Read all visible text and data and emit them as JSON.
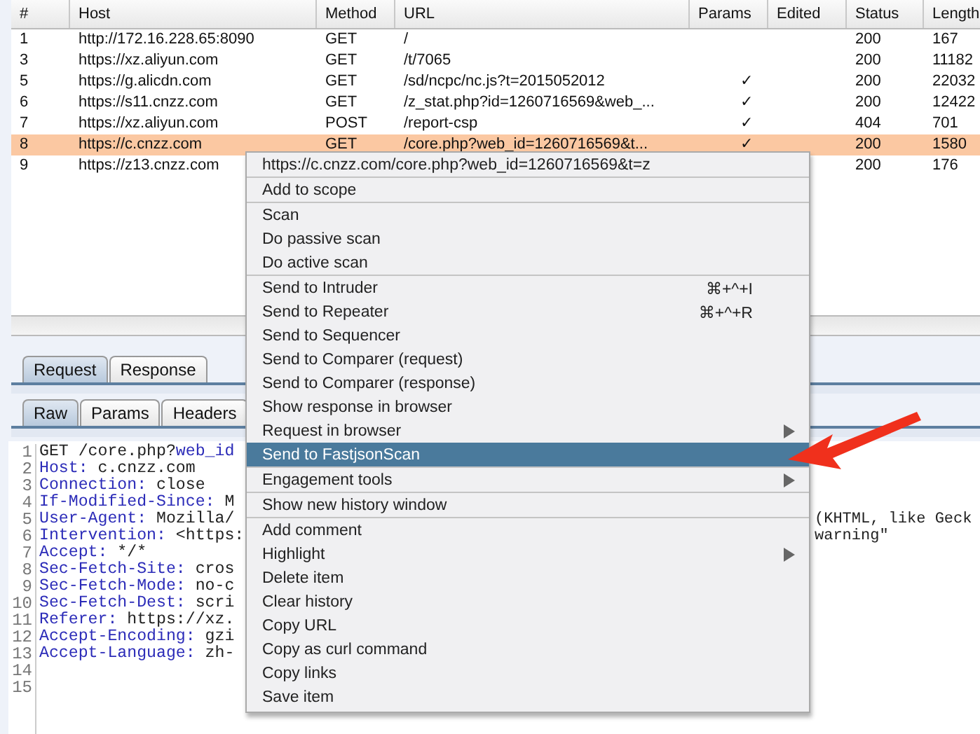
{
  "table": {
    "columns": [
      "#",
      "Host",
      "Method",
      "URL",
      "Params",
      "Edited",
      "Status",
      "Length"
    ],
    "rows": [
      {
        "num": "1",
        "host": "http://172.16.228.65:8090",
        "method": "GET",
        "url": "/",
        "status": "200",
        "length": "167",
        "selected": false
      },
      {
        "num": "3",
        "host": "https://xz.aliyun.com",
        "method": "GET",
        "url": "/t/7065",
        "status": "200",
        "length": "11182",
        "selected": false
      },
      {
        "num": "5",
        "host": "https://g.alicdn.com",
        "method": "GET",
        "url": "/sd/ncpc/nc.js?t=2015052012",
        "params": "✓",
        "status": "200",
        "length": "22032",
        "selected": false
      },
      {
        "num": "6",
        "host": "https://s11.cnzz.com",
        "method": "GET",
        "url": "/z_stat.php?id=1260716569&web_...",
        "params": "✓",
        "status": "200",
        "length": "12422",
        "selected": false
      },
      {
        "num": "7",
        "host": "https://xz.aliyun.com",
        "method": "POST",
        "url": "/report-csp",
        "params": "✓",
        "status": "404",
        "length": "701",
        "selected": false
      },
      {
        "num": "8",
        "host": "https://c.cnzz.com",
        "method": "GET",
        "url": "/core.php?web_id=1260716569&t...",
        "params": "✓",
        "status": "200",
        "length": "1580",
        "selected": true
      },
      {
        "num": "9",
        "host": "https://z13.cnzz.com",
        "status": "200",
        "length": "176",
        "selected": false
      }
    ]
  },
  "message_tabs": [
    {
      "label": "Request",
      "selected": true
    },
    {
      "label": "Response",
      "selected": false
    }
  ],
  "view_tabs": [
    {
      "label": "Raw",
      "selected": true
    },
    {
      "label": "Params",
      "selected": false
    },
    {
      "label": "Headers",
      "selected": false
    }
  ],
  "editor": {
    "lines": [
      {
        "num": "1",
        "parts": [
          {
            "kind": "plain",
            "text": "GET /core.php?"
          },
          {
            "kind": "key",
            "text": "web_id"
          }
        ]
      },
      {
        "num": "2",
        "parts": [
          {
            "kind": "key",
            "text": "Host:"
          },
          {
            "kind": "plain",
            "text": " c.cnzz.com"
          }
        ]
      },
      {
        "num": "3",
        "parts": [
          {
            "kind": "key",
            "text": "Connection:"
          },
          {
            "kind": "plain",
            "text": " close"
          }
        ]
      },
      {
        "num": "4",
        "parts": [
          {
            "kind": "key",
            "text": "If-Modified-Since:"
          },
          {
            "kind": "plain",
            "text": " M"
          }
        ]
      },
      {
        "num": "5",
        "parts": [
          {
            "kind": "key",
            "text": "User-Agent:"
          },
          {
            "kind": "plain",
            "text": " Mozilla/"
          }
        ],
        "right": "(KHTML, like Geck"
      },
      {
        "num": "6",
        "parts": [
          {
            "kind": "key",
            "text": "Intervention:"
          },
          {
            "kind": "plain",
            "text": " <https:"
          }
        ],
        "right": "warning\""
      },
      {
        "num": "7",
        "parts": [
          {
            "kind": "key",
            "text": "Accept:"
          },
          {
            "kind": "plain",
            "text": " */*"
          }
        ]
      },
      {
        "num": "8",
        "parts": [
          {
            "kind": "key",
            "text": "Sec-Fetch-Site:"
          },
          {
            "kind": "plain",
            "text": " cros"
          }
        ]
      },
      {
        "num": "9",
        "parts": [
          {
            "kind": "key",
            "text": "Sec-Fetch-Mode:"
          },
          {
            "kind": "plain",
            "text": " no-c"
          }
        ]
      },
      {
        "num": "10",
        "parts": [
          {
            "kind": "key",
            "text": "Sec-Fetch-Dest:"
          },
          {
            "kind": "plain",
            "text": " scri"
          }
        ]
      },
      {
        "num": "11",
        "parts": [
          {
            "kind": "key",
            "text": "Referer:"
          },
          {
            "kind": "plain",
            "text": " https://xz."
          }
        ]
      },
      {
        "num": "12",
        "parts": [
          {
            "kind": "key",
            "text": "Accept-Encoding:"
          },
          {
            "kind": "plain",
            "text": " gzi"
          }
        ]
      },
      {
        "num": "13",
        "parts": [
          {
            "kind": "key",
            "text": "Accept-Language:"
          },
          {
            "kind": "plain",
            "text": " zh-"
          }
        ]
      },
      {
        "num": "14"
      },
      {
        "num": "15"
      }
    ]
  },
  "context_menu": {
    "groups": [
      [
        {
          "label": "https://c.cnzz.com/core.php?web_id=1260716569&t=z",
          "has_submenu": false,
          "selected": false
        }
      ],
      [
        {
          "label": "Add to scope",
          "has_submenu": false,
          "selected": false
        }
      ],
      [
        {
          "label": "Scan",
          "has_submenu": false,
          "selected": false
        },
        {
          "label": "Do passive scan",
          "has_submenu": false,
          "selected": false
        },
        {
          "label": "Do active scan",
          "has_submenu": false,
          "selected": false
        }
      ],
      [
        {
          "label": "Send to Intruder",
          "shortcut": "⌘+^+I",
          "has_submenu": false,
          "selected": false
        },
        {
          "label": "Send to Repeater",
          "shortcut": "⌘+^+R",
          "has_submenu": false,
          "selected": false
        },
        {
          "label": "Send to Sequencer",
          "has_submenu": false,
          "selected": false
        },
        {
          "label": "Send to Comparer (request)",
          "has_submenu": false,
          "selected": false
        },
        {
          "label": "Send to Comparer (response)",
          "has_submenu": false,
          "selected": false
        },
        {
          "label": "Show response in browser",
          "has_submenu": false,
          "selected": false
        },
        {
          "label": "Request in browser",
          "has_submenu": true,
          "selected": false
        },
        {
          "label": "Send to FastjsonScan",
          "has_submenu": false,
          "selected": true
        }
      ],
      [
        {
          "label": "Engagement tools",
          "has_submenu": true,
          "selected": false
        }
      ],
      [
        {
          "label": "Show new history window",
          "has_submenu": false,
          "selected": false
        }
      ],
      [
        {
          "label": "Add comment",
          "has_submenu": false,
          "selected": false
        },
        {
          "label": "Highlight",
          "has_submenu": true,
          "selected": false
        },
        {
          "label": "Delete item",
          "has_submenu": false,
          "selected": false
        },
        {
          "label": "Clear history",
          "has_submenu": false,
          "selected": false
        },
        {
          "label": "Copy URL",
          "has_submenu": false,
          "selected": false
        },
        {
          "label": "Copy as curl command",
          "has_submenu": false,
          "selected": false
        },
        {
          "label": "Copy links",
          "has_submenu": false,
          "selected": false
        },
        {
          "label": "Save item",
          "has_submenu": false,
          "selected": false
        }
      ]
    ]
  }
}
